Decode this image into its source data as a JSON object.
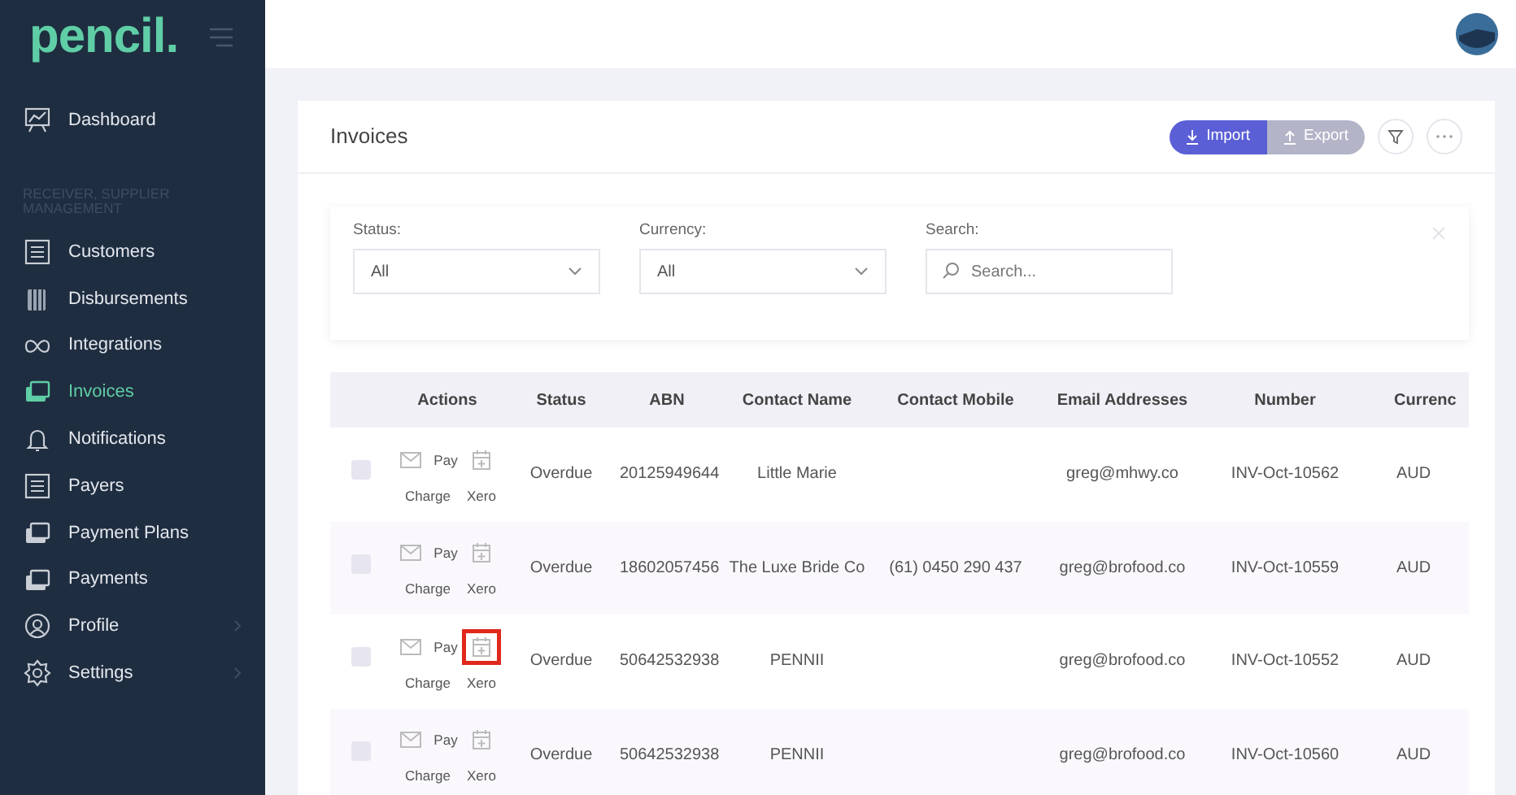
{
  "sidebar": {
    "logo": "pencil.",
    "items": [
      {
        "kind": "item",
        "label": "Dashboard",
        "selected": false,
        "has_submenu": false
      },
      {
        "kind": "section",
        "label": "RECEIVER, SUPPLIER MANAGEMENT"
      },
      {
        "kind": "item",
        "label": "Customers",
        "selected": false,
        "has_submenu": false
      },
      {
        "kind": "item",
        "label": "Disbursements",
        "selected": false,
        "has_submenu": false
      },
      {
        "kind": "item",
        "label": "Integrations",
        "selected": false,
        "has_submenu": false
      },
      {
        "kind": "item",
        "label": "Invoices",
        "selected": true,
        "has_submenu": false
      },
      {
        "kind": "item",
        "label": "Notifications",
        "selected": false,
        "has_submenu": false
      },
      {
        "kind": "item",
        "label": "Payers",
        "selected": false,
        "has_submenu": false
      },
      {
        "kind": "item",
        "label": "Payment Plans",
        "selected": false,
        "has_submenu": false
      },
      {
        "kind": "item",
        "label": "Payments",
        "selected": false,
        "has_submenu": false
      },
      {
        "kind": "item",
        "label": "Profile",
        "selected": false,
        "has_submenu": true
      },
      {
        "kind": "item",
        "label": "Settings",
        "selected": false,
        "has_submenu": true
      }
    ]
  },
  "page": {
    "title": "Invoices",
    "buttons": [
      {
        "label": "Import",
        "disabled": false
      },
      {
        "label": "Export",
        "disabled": true
      }
    ]
  },
  "filters": {
    "status": {
      "label": "Status:",
      "value": "All"
    },
    "currency": {
      "label": "Currency:",
      "value": "All"
    },
    "search": {
      "label": "Search:",
      "placeholder": "Search..."
    }
  },
  "table": {
    "columns": [
      "Actions",
      "Status",
      "ABN",
      "Contact Name",
      "Contact Mobile",
      "Email Addresses",
      "Number",
      "Currenc"
    ],
    "rows": [
      {
        "checked": false,
        "pay": "Pay",
        "charge": "Charge",
        "xero": "Xero",
        "xero_highlighted": false,
        "status": "Overdue",
        "abn": "20125949644",
        "contact_name": "Little Marie",
        "contact_mobile": "",
        "email": "greg@mhwy.co",
        "number": "INV-Oct-10562",
        "currency": "AUD"
      },
      {
        "checked": false,
        "pay": "Pay",
        "charge": "Charge",
        "xero": "Xero",
        "xero_highlighted": false,
        "status": "Overdue",
        "abn": "18602057456",
        "contact_name": "The Luxe Bride Co",
        "contact_mobile": "(61) 0450 290 437",
        "email": "greg@brofood.co",
        "number": "INV-Oct-10559",
        "currency": "AUD"
      },
      {
        "checked": false,
        "pay": "Pay",
        "charge": "Charge",
        "xero": "Xero",
        "xero_highlighted": true,
        "status": "Overdue",
        "abn": "50642532938",
        "contact_name": "PENNII",
        "contact_mobile": "",
        "email": "greg@brofood.co",
        "number": "INV-Oct-10552",
        "currency": "AUD"
      },
      {
        "checked": false,
        "pay": "Pay",
        "charge": "Charge",
        "xero": "Xero",
        "xero_highlighted": false,
        "status": "Overdue",
        "abn": "50642532938",
        "contact_name": "PENNII",
        "contact_mobile": "",
        "email": "greg@brofood.co",
        "number": "INV-Oct-10560",
        "currency": "AUD"
      }
    ]
  }
}
